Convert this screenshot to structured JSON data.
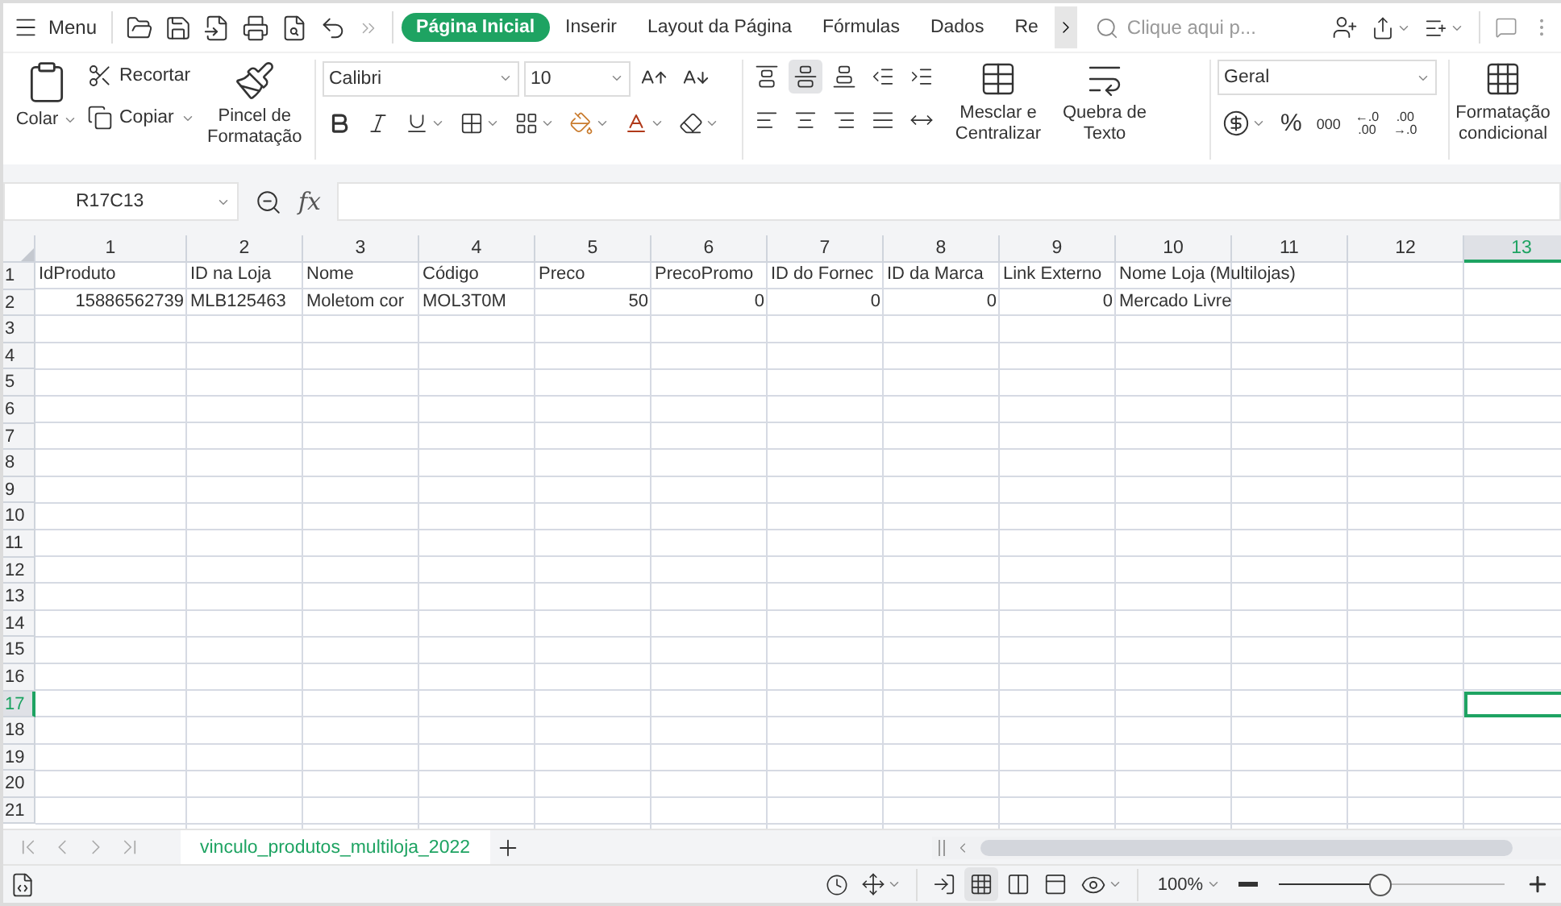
{
  "menu": "Menu",
  "tabs": [
    {
      "label": "Página Inicial",
      "selected": true
    },
    {
      "label": "Inserir",
      "selected": false
    },
    {
      "label": "Layout da Página",
      "selected": false
    },
    {
      "label": "Fórmulas",
      "selected": false
    },
    {
      "label": "Dados",
      "selected": false
    },
    {
      "label": "Re",
      "selected": false
    }
  ],
  "search": {
    "placeholder": "Clique aqui p..."
  },
  "ribbon": {
    "clipboard": {
      "paste": "Colar",
      "cut": "Recortar",
      "copy": "Copiar",
      "format_painter": "Pincel de Formatação"
    },
    "font": {
      "name": "Calibri",
      "size": "10"
    },
    "align_buttons": [
      {
        "kind": "top",
        "selected": false
      },
      {
        "kind": "middle",
        "selected": true
      },
      {
        "kind": "bottom",
        "selected": false
      },
      {
        "kind": "outdent",
        "selected": false
      },
      {
        "kind": "indent",
        "selected": false
      },
      {
        "kind": "left",
        "selected": false
      },
      {
        "kind": "center",
        "selected": false
      },
      {
        "kind": "right",
        "selected": false
      },
      {
        "kind": "justify",
        "selected": false
      },
      {
        "kind": "distributed",
        "selected": false
      }
    ],
    "merge": "Mesclar e Centralizar",
    "wrap": "Quebra de Texto",
    "number": {
      "format": "Geral",
      "percent": "%",
      "thousands": "000",
      "increase_decimal": [
        "←.0",
        ".00"
      ],
      "decrease_decimal": [
        ".00",
        "→.0"
      ]
    },
    "conditional_formatting": "Formatação condicional"
  },
  "name_box": "R17C13",
  "formula_label": "fx",
  "columns": [
    {
      "label": "1",
      "selected": false
    },
    {
      "label": "2",
      "selected": false
    },
    {
      "label": "3",
      "selected": false
    },
    {
      "label": "4",
      "selected": false
    },
    {
      "label": "5",
      "selected": false
    },
    {
      "label": "6",
      "selected": false
    },
    {
      "label": "7",
      "selected": false
    },
    {
      "label": "8",
      "selected": false
    },
    {
      "label": "9",
      "selected": false
    },
    {
      "label": "10",
      "selected": false
    },
    {
      "label": "11",
      "selected": false
    },
    {
      "label": "12",
      "selected": false
    },
    {
      "label": "13",
      "selected": true
    }
  ],
  "rows": [
    {
      "label": "1",
      "selected": false,
      "cells": [
        {
          "text": "IdProduto",
          "kind": "text"
        },
        {
          "text": "ID na Loja",
          "kind": "text"
        },
        {
          "text": "Nome",
          "kind": "text"
        },
        {
          "text": "Código",
          "kind": "text"
        },
        {
          "text": "Preco",
          "kind": "text"
        },
        {
          "text": "PrecoPromo",
          "kind": "text"
        },
        {
          "text": "ID do Fornec",
          "kind": "text"
        },
        {
          "text": "ID da Marca",
          "kind": "text"
        },
        {
          "text": "Link Externo",
          "kind": "text"
        },
        {
          "text": "Nome Loja (Multilojas)",
          "kind": "text"
        }
      ]
    },
    {
      "label": "2",
      "selected": false,
      "cells": [
        {
          "text": "15886562739",
          "kind": "number"
        },
        {
          "text": "MLB125463",
          "kind": "text"
        },
        {
          "text": "Moletom cor",
          "kind": "text"
        },
        {
          "text": "MOL3T0M",
          "kind": "text"
        },
        {
          "text": "50",
          "kind": "number"
        },
        {
          "text": "0",
          "kind": "number"
        },
        {
          "text": "0",
          "kind": "number"
        },
        {
          "text": "0",
          "kind": "number"
        },
        {
          "text": "0",
          "kind": "number"
        },
        {
          "text": "Mercado Livre",
          "kind": "text"
        }
      ]
    },
    {
      "label": "3",
      "selected": false
    },
    {
      "label": "4",
      "selected": false
    },
    {
      "label": "5",
      "selected": false
    },
    {
      "label": "6",
      "selected": false
    },
    {
      "label": "7",
      "selected": false
    },
    {
      "label": "8",
      "selected": false
    },
    {
      "label": "9",
      "selected": false
    },
    {
      "label": "10",
      "selected": false
    },
    {
      "label": "11",
      "selected": false
    },
    {
      "label": "12",
      "selected": false
    },
    {
      "label": "13",
      "selected": false
    },
    {
      "label": "14",
      "selected": false
    },
    {
      "label": "15",
      "selected": false
    },
    {
      "label": "16",
      "selected": false
    },
    {
      "label": "17",
      "selected": true
    },
    {
      "label": "18",
      "selected": false
    },
    {
      "label": "19",
      "selected": false
    },
    {
      "label": "20",
      "selected": false
    },
    {
      "label": "21",
      "selected": false
    }
  ],
  "sheet_tabs": [
    {
      "label": "vinculo_produtos_multiloja_2022",
      "selected": true
    }
  ],
  "status_bar": {
    "zoom": "100%",
    "zoom_slider": {
      "level": 0.45
    }
  }
}
